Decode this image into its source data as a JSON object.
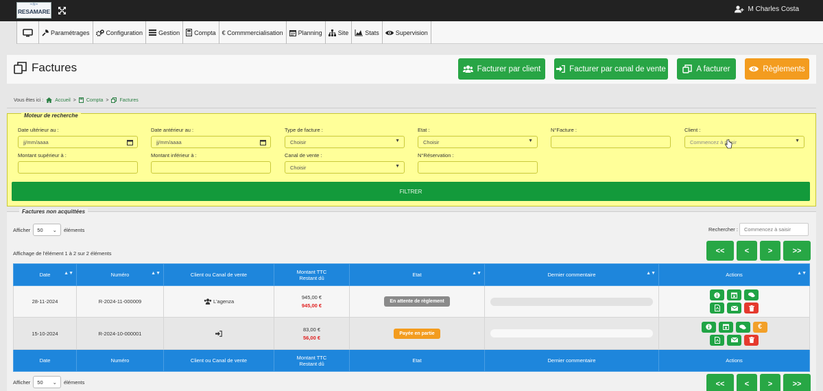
{
  "topbar": {
    "logo_text": "RESAMARE",
    "user_name": "M Charles Costa"
  },
  "menu": {
    "items": [
      {
        "label": "",
        "icon": "monitor-icon"
      },
      {
        "label": "Paramétrages",
        "icon": "wrench-icon"
      },
      {
        "label": "Configuration",
        "icon": "cogs-icon"
      },
      {
        "label": "Gestion",
        "icon": "list-icon"
      },
      {
        "label": "Compta",
        "icon": "calculator-icon"
      },
      {
        "label": "€ Commmercialisation",
        "icon": ""
      },
      {
        "label": "Planning",
        "icon": "calendar-icon"
      },
      {
        "label": "Site",
        "icon": "sitemap-icon"
      },
      {
        "label": "Stats",
        "icon": "area-chart-icon"
      },
      {
        "label": "Supervision",
        "icon": "eye-icon"
      }
    ]
  },
  "page": {
    "title": "Factures"
  },
  "actions": {
    "by_client": "Facturer par client",
    "by_channel": "Facturer par canal de vente",
    "to_invoice": "A facturer",
    "payments": "Règlements"
  },
  "breadcrumb": {
    "prefix": "Vous êtes ici :",
    "home": "Accueil",
    "compta": "Compta",
    "factures": "Factures",
    "sep": ">"
  },
  "search": {
    "legend": "Moteur de recherche",
    "date_after_label": "Date ultérieur au :",
    "date_after_ph": "jj/mm/aaaa",
    "date_before_label": "Date antérieur au :",
    "date_before_ph": "jj/mm/aaaa",
    "type_label": "Type de facture :",
    "type_value": "Choisir",
    "etat_label": "Etat :",
    "etat_value": "Choisir",
    "num_label": "N°Facture :",
    "client_label": "Client :",
    "client_ph": "Commencez à saisir",
    "min_label": "Montant supérieur à :",
    "max_label": "Montant inférieur à :",
    "canal_label": "Canal de vente :",
    "canal_value": "Choisir",
    "resa_label": "N°Réservation :",
    "filter_button": "FILTRER"
  },
  "list": {
    "legend": "Factures non acquittées",
    "show_label": "Afficher",
    "page_size": "50",
    "elements_label": "éléments",
    "search_label": "Rechercher :",
    "search_ph": "Commencez à saisir",
    "info": "Affichage de l'élément 1 à 2 sur 2 éléments",
    "pager": {
      "first": "<<",
      "prev": "<",
      "next": ">",
      "last": ">>"
    },
    "columns": {
      "date": "Date",
      "numero": "Numéro",
      "client": "Client ou Canal de vente",
      "montant1": "Montant TTC",
      "montant2": "Restant dû",
      "etat": "Etat",
      "comment": "Dernier commentaire",
      "actions": "Actions"
    },
    "rows": [
      {
        "date": "28-11-2024",
        "numero": "R-2024-11-000009",
        "client": "L'agenza",
        "client_icon": "users-icon",
        "montant": "945,00 €",
        "restant": "945,00 €",
        "etat": "En attente de règlement",
        "etat_color": "#8a8a8a"
      },
      {
        "date": "15-10-2024",
        "numero": "R-2024-10-000001",
        "client": "",
        "client_icon": "sign-in-icon",
        "montant": "83,00 €",
        "restant": "56,00 €",
        "etat": "Payée en partie",
        "etat_color": "#f39c1f"
      }
    ]
  },
  "colors": {
    "green": "#28a545",
    "orange": "#f39c1f",
    "blue": "#1e86dc",
    "yellow": "#ffff99"
  }
}
